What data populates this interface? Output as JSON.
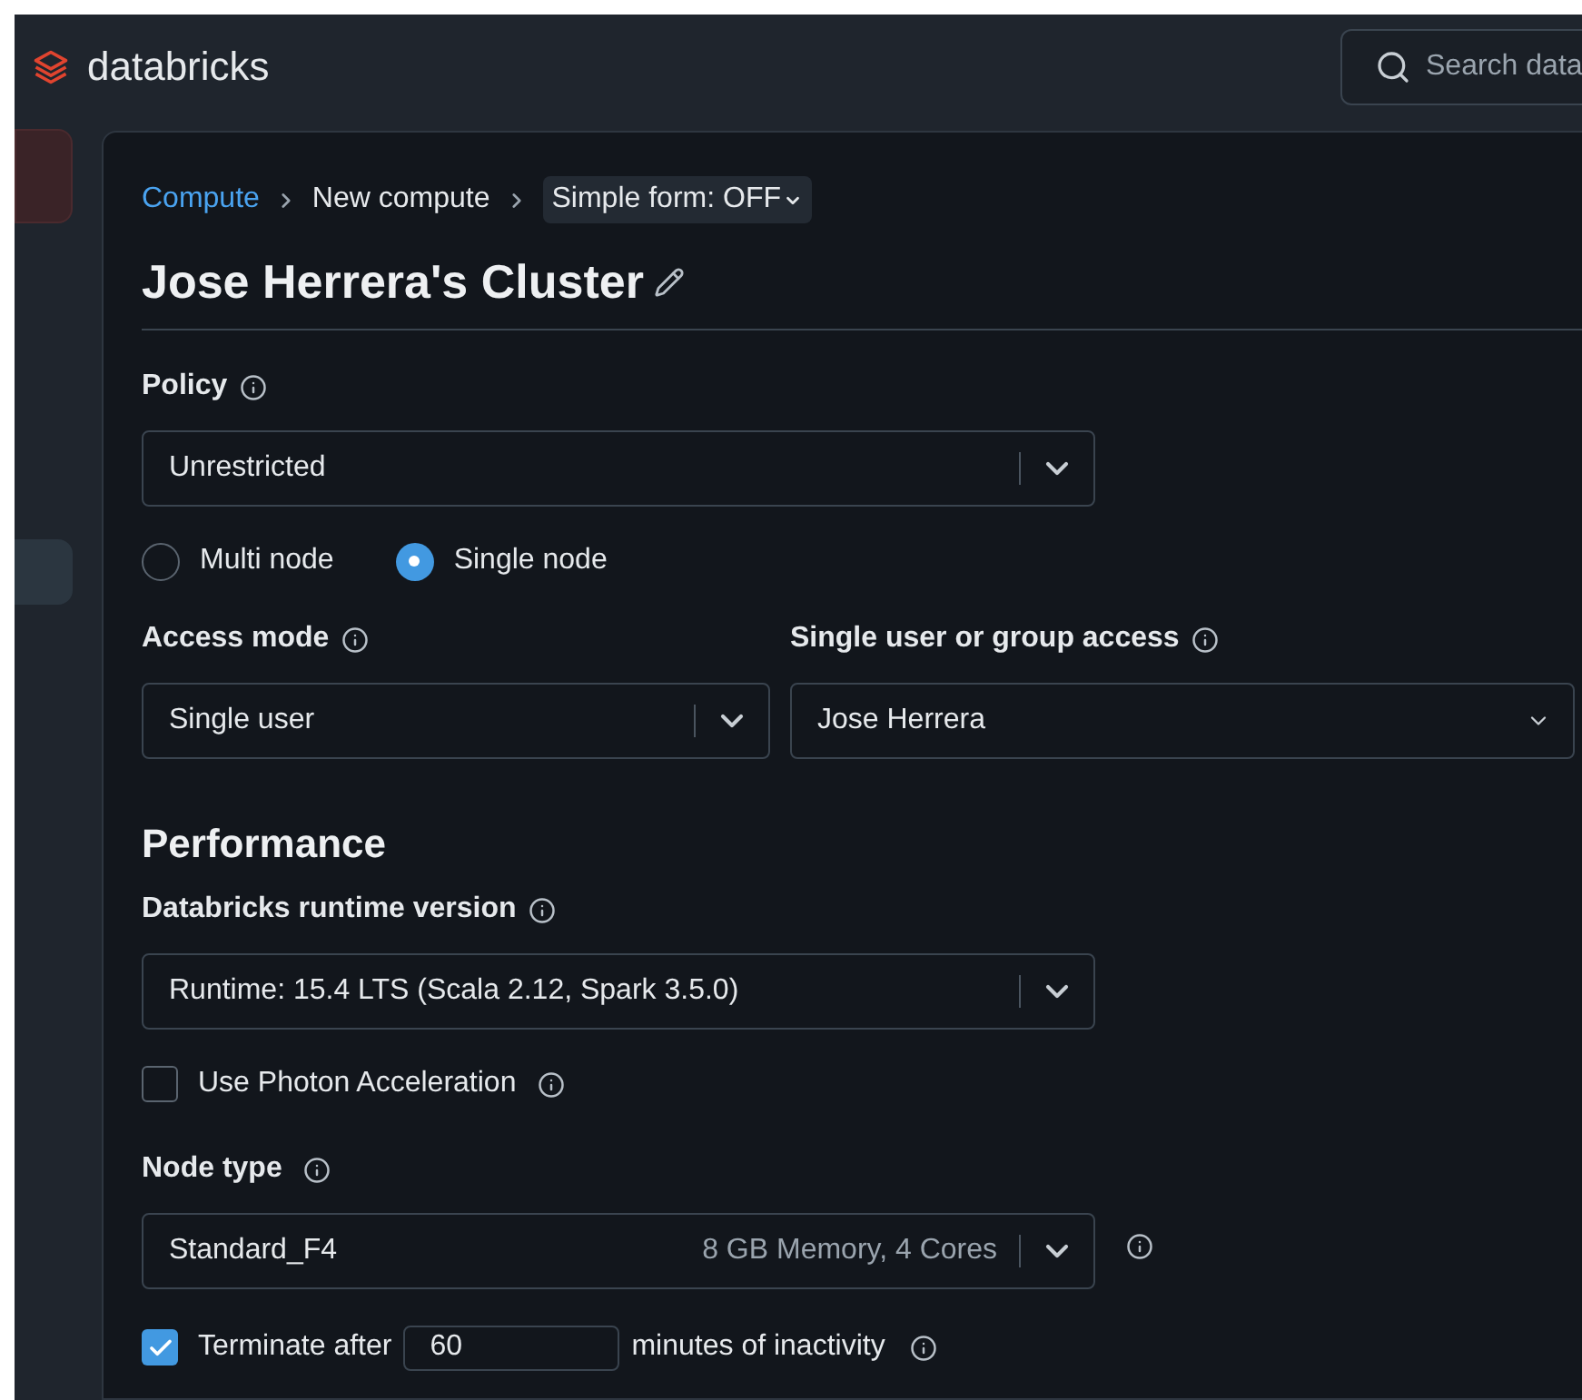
{
  "header": {
    "logo": "databricks",
    "search": {
      "placeholder": "Search data"
    }
  },
  "sidebar": {
    "items": [
      {
        "selected": true
      },
      {
        "selected": false
      }
    ]
  },
  "breadcrumb": {
    "items": [
      "Compute",
      "New compute"
    ],
    "form_toggle": "Simple form: OFF"
  },
  "title": "Jose Herrera's Cluster",
  "policy": {
    "label": "Policy",
    "value": "Unrestricted"
  },
  "node_mode": [
    {
      "label": "Multi node",
      "selected": false
    },
    {
      "label": "Single node",
      "selected": true
    }
  ],
  "access_mode": {
    "label": "Access mode",
    "value": "Single user"
  },
  "user_access": {
    "label": "Single user or group access",
    "value": "Jose Herrera"
  },
  "performance": {
    "heading": "Performance",
    "runtime": {
      "label": "Databricks runtime version",
      "value": "Runtime: 15.4 LTS (Scala 2.12, Spark 3.5.0)"
    },
    "photon": {
      "label": "Use Photon Acceleration",
      "checked": false
    },
    "node_type": {
      "label": "Node type",
      "value": "Standard_F4",
      "detail": "8 GB Memory, 4 Cores"
    },
    "terminate": {
      "checked": true,
      "label_before": "Terminate after",
      "value": "60",
      "label_after": "minutes of inactivity"
    }
  }
}
